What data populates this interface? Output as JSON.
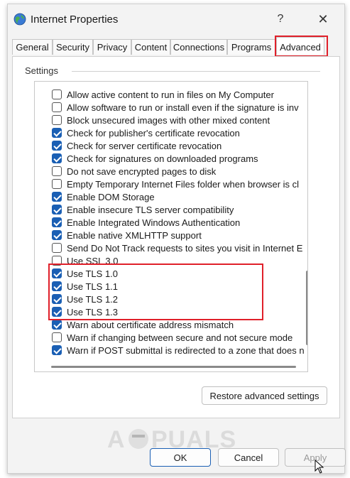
{
  "window": {
    "title": "Internet Properties",
    "help_symbol": "?",
    "close_symbol": "✕",
    "app_icon": "globe-icon"
  },
  "tabs": [
    {
      "label": "General",
      "active": false
    },
    {
      "label": "Security",
      "active": false
    },
    {
      "label": "Privacy",
      "active": false
    },
    {
      "label": "Content",
      "active": false
    },
    {
      "label": "Connections",
      "active": false
    },
    {
      "label": "Programs",
      "active": false
    },
    {
      "label": "Advanced",
      "active": true
    }
  ],
  "settings_group_label": "Settings",
  "settings": [
    {
      "label": "Allow active content to run in files on My Computer",
      "checked": false
    },
    {
      "label": "Allow software to run or install even if the signature is inv",
      "checked": false
    },
    {
      "label": "Block unsecured images with other mixed content",
      "checked": false
    },
    {
      "label": "Check for publisher's certificate revocation",
      "checked": true
    },
    {
      "label": "Check for server certificate revocation",
      "checked": true
    },
    {
      "label": "Check for signatures on downloaded programs",
      "checked": true
    },
    {
      "label": "Do not save encrypted pages to disk",
      "checked": false
    },
    {
      "label": "Empty Temporary Internet Files folder when browser is cl",
      "checked": false
    },
    {
      "label": "Enable DOM Storage",
      "checked": true
    },
    {
      "label": "Enable insecure TLS server compatibility",
      "checked": true
    },
    {
      "label": "Enable Integrated Windows Authentication",
      "checked": true
    },
    {
      "label": "Enable native XMLHTTP support",
      "checked": true
    },
    {
      "label": "Send Do Not Track requests to sites you visit in Internet E",
      "checked": false
    },
    {
      "label": "Use SSL 3.0",
      "checked": false
    },
    {
      "label": "Use TLS 1.0",
      "checked": true
    },
    {
      "label": "Use TLS 1.1",
      "checked": true
    },
    {
      "label": "Use TLS 1.2",
      "checked": true
    },
    {
      "label": "Use TLS 1.3",
      "checked": true
    },
    {
      "label": "Warn about certificate address mismatch",
      "checked": true
    },
    {
      "label": "Warn if changing between secure and not secure mode",
      "checked": false
    },
    {
      "label": "Warn if POST submittal is redirected to a zone that does n",
      "checked": true
    }
  ],
  "buttons": {
    "restore": "Restore advanced settings",
    "ok": "OK",
    "cancel": "Cancel",
    "apply": "Apply"
  },
  "watermark": {
    "text": "APPUALS"
  },
  "colors": {
    "highlight": "#e0202a",
    "checkbox_checked": "#1a5fb4"
  }
}
